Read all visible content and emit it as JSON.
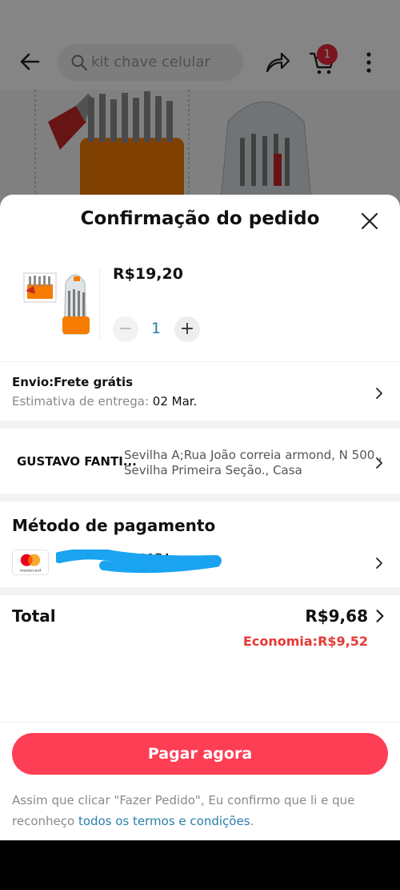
{
  "background": {
    "search_placeholder": "kit chave celular",
    "cart_count": "1"
  },
  "sheet": {
    "title": "Confirmação do pedido"
  },
  "product": {
    "price": "R$19,20",
    "quantity": "1",
    "minus_label": "−",
    "plus_label": "+"
  },
  "shipping": {
    "title": "Envio:Frete grátis",
    "estimate_label": "Estimativa de entrega:",
    "estimate_date": "02 Mar."
  },
  "address": {
    "name": "GUSTAVO FANTI...",
    "line1": "Sevilha A;Rua João correia armond,  N 500 ,",
    "line2": "Sevilha Primeira Seção., Casa"
  },
  "payment": {
    "title": "Método de pagamento",
    "card_brand": "mastercard",
    "card_number": "**** **** **** 0174"
  },
  "total": {
    "label": "Total",
    "value": "R$9,68",
    "saving": "Economia:R$9,52"
  },
  "actions": {
    "pay_button": "Pagar agora"
  },
  "terms": {
    "text": "Assim que clicar \"Fazer Pedido\", Eu confirmo que li e que reconheço ",
    "link": "todos os termos e condições",
    "end": "."
  },
  "colors": {
    "accent": "#fe3e55",
    "link": "#2b7fa8",
    "saving": "#e53935",
    "badge": "#e8293a"
  }
}
